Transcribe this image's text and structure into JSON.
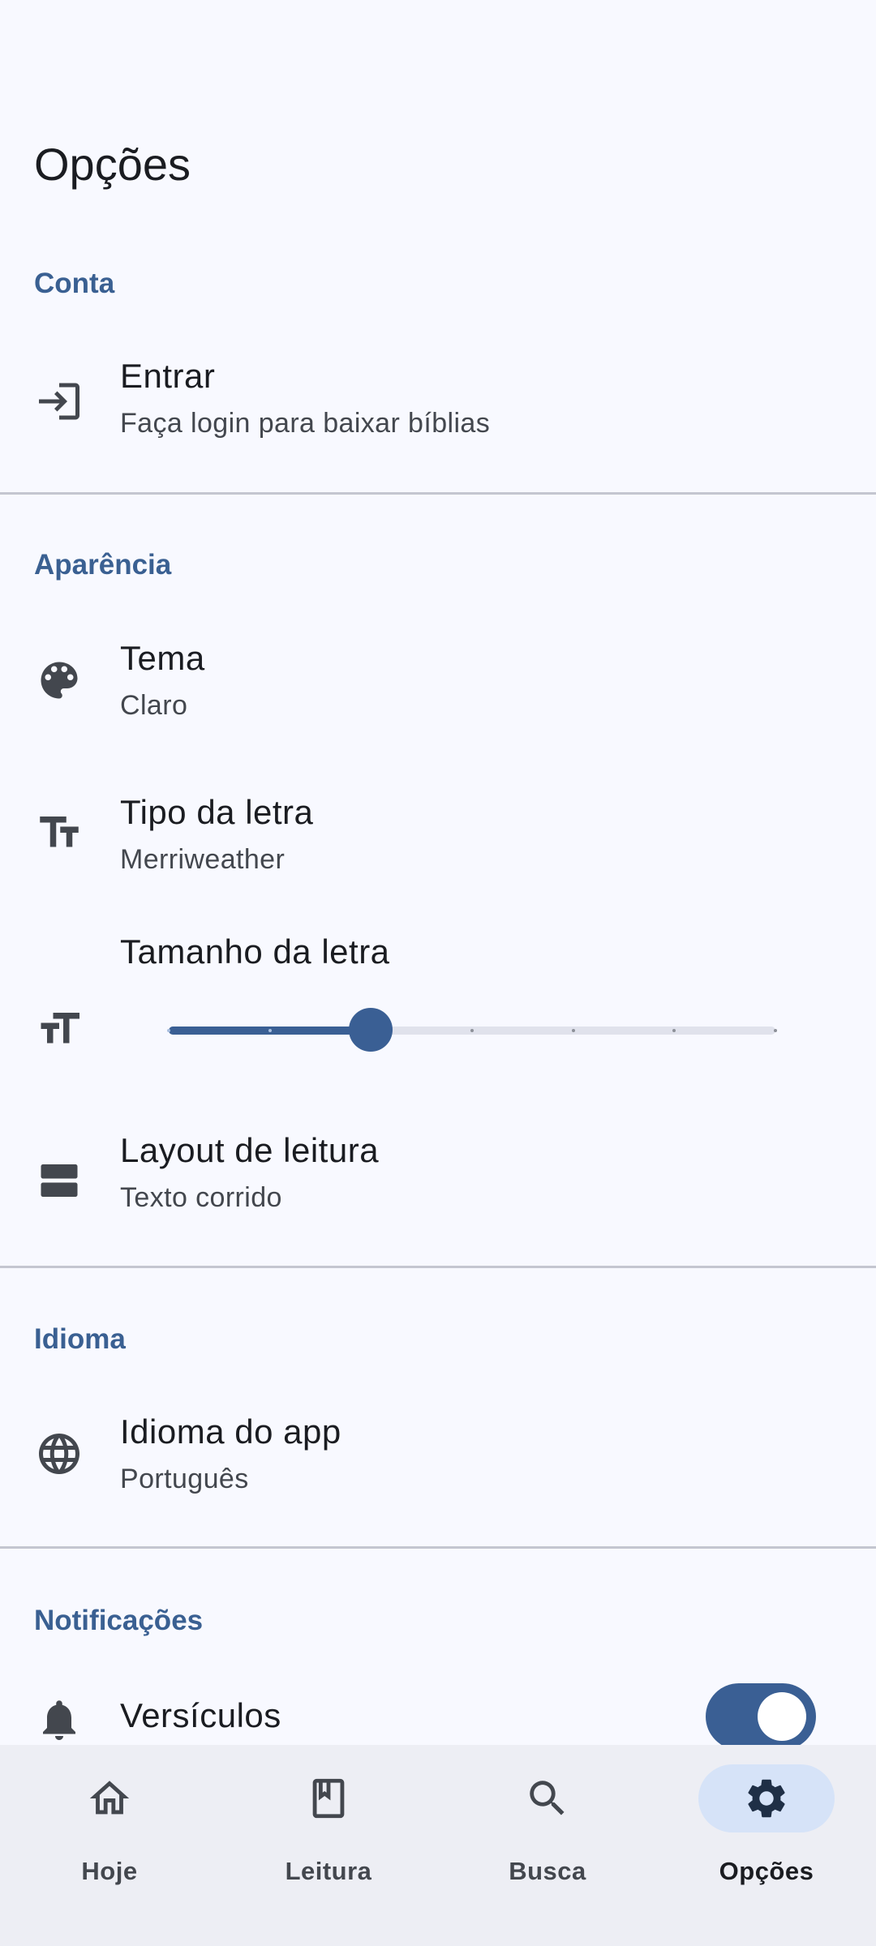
{
  "page": {
    "title": "Opções"
  },
  "sections": {
    "account": {
      "header": "Conta",
      "login": {
        "title": "Entrar",
        "subtitle": "Faça login para baixar bíblias"
      }
    },
    "appearance": {
      "header": "Aparência",
      "theme": {
        "title": "Tema",
        "subtitle": "Claro"
      },
      "font_type": {
        "title": "Tipo da letra",
        "subtitle": "Merriweather"
      },
      "font_size": {
        "title": "Tamanho da letra",
        "slider_steps": 7,
        "slider_index": 2
      },
      "reading_layout": {
        "title": "Layout de leitura",
        "subtitle": "Texto corrido"
      }
    },
    "language": {
      "header": "Idioma",
      "app_language": {
        "title": "Idioma do app",
        "subtitle": "Português"
      }
    },
    "notifications": {
      "header": "Notificações",
      "verses": {
        "title": "Versículos",
        "enabled": true
      }
    }
  },
  "bottom_nav": {
    "items": [
      {
        "label": "Hoje",
        "icon": "home-icon"
      },
      {
        "label": "Leitura",
        "icon": "book-icon"
      },
      {
        "label": "Busca",
        "icon": "search-icon"
      },
      {
        "label": "Opções",
        "icon": "settings-icon",
        "active": true
      }
    ]
  },
  "colors": {
    "accent": "#3a5f94",
    "section_header": "#3a6092",
    "background": "#f8f9ff",
    "nav_background": "#edeef4",
    "nav_active_pill": "#d6e3f8"
  }
}
